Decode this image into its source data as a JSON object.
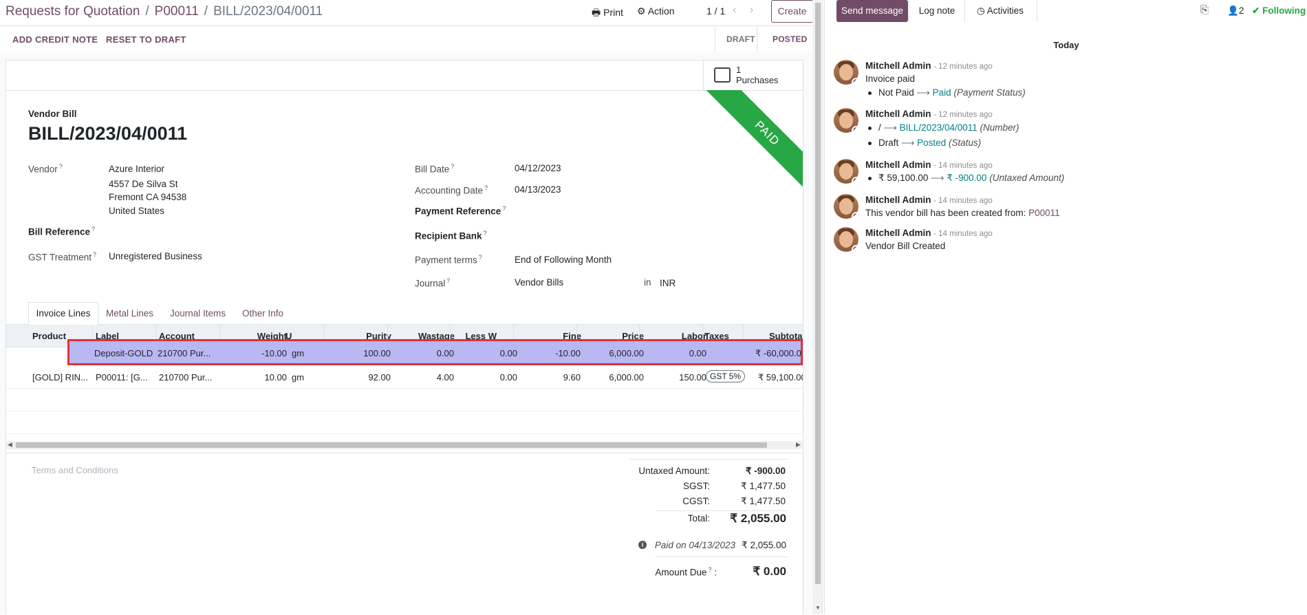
{
  "breadcrumb": {
    "items": [
      "Requests for Quotation",
      "P00011"
    ],
    "current": "BILL/2023/04/0011"
  },
  "toolbar": {
    "print_label": "Print",
    "action_label": "Action",
    "pager": "1 / 1",
    "create_label": "Create"
  },
  "statusbar": {
    "add_credit_note": "ADD CREDIT NOTE",
    "reset_to_draft": "RESET TO DRAFT",
    "stages": [
      "DRAFT",
      "POSTED"
    ],
    "active_stage": "POSTED"
  },
  "smart_button": {
    "count": "1",
    "label": "Purchases"
  },
  "ribbon": "PAID",
  "form": {
    "type_label": "Vendor Bill",
    "name": "BILL/2023/04/0011",
    "vendor_label": "Vendor",
    "vendor_name": "Azure Interior",
    "vendor_address": [
      "4557 De Silva St",
      "Fremont CA 94538",
      "United States"
    ],
    "bill_reference_label": "Bill Reference",
    "gst_treatment_label": "GST Treatment",
    "gst_treatment_value": "Unregistered Business",
    "bill_date_label": "Bill Date",
    "bill_date": "04/12/2023",
    "accounting_date_label": "Accounting Date",
    "accounting_date": "04/13/2023",
    "payment_reference_label": "Payment Reference",
    "recipient_bank_label": "Recipient Bank",
    "payment_terms_label": "Payment terms",
    "payment_terms": "End of Following Month",
    "journal_label": "Journal",
    "journal": "Vendor Bills",
    "journal_in": "in",
    "currency": "INR"
  },
  "tabs": [
    "Invoice Lines",
    "Metal Lines",
    "Journal Items",
    "Other Info"
  ],
  "active_tab": "Invoice Lines",
  "table": {
    "headers": [
      "Product",
      "Label",
      "Account",
      "Weight",
      "U",
      "Purity",
      "Wastage",
      "Less W",
      "Fine",
      "Price",
      "Labor",
      "Taxes",
      "Subtota"
    ],
    "rows": [
      {
        "product": "",
        "label": "Deposit-GOLD",
        "account": "210700 Pur...",
        "weight": "-10.00",
        "uom": "gm",
        "purity": "100.00",
        "wastage": "0.00",
        "less_w": "0.00",
        "fine": "-10.00",
        "price": "6,000.00",
        "labor": "0.00",
        "taxes": "",
        "subtotal": "₹ -60,000.0"
      },
      {
        "product": "[GOLD] RIN...",
        "label": "P00011: [G...",
        "account": "210700 Pur...",
        "weight": "10.00",
        "uom": "gm",
        "purity": "92.00",
        "wastage": "4.00",
        "less_w": "0.00",
        "fine": "9.60",
        "price": "6,000.00",
        "labor": "150.00",
        "taxes": "GST 5%",
        "subtotal": "₹ 59,100.00"
      }
    ]
  },
  "terms_placeholder": "Terms and Conditions",
  "totals": {
    "untaxed_label": "Untaxed Amount:",
    "untaxed": "₹ -900.00",
    "sgst_label": "SGST:",
    "sgst": "₹ 1,477.50",
    "cgst_label": "CGST:",
    "cgst": "₹ 1,477.50",
    "total_label": "Total:",
    "total": "₹ 2,055.00",
    "paid_on": "Paid on 04/13/2023",
    "paid_amount": "₹ 2,055.00",
    "amount_due_label": "Amount Due",
    "amount_due": "₹ 0.00"
  },
  "chatter": {
    "send_message": "Send message",
    "log_note": "Log note",
    "activities": "Activities",
    "followers_count": "2",
    "following": "Following",
    "date_separator": "Today",
    "messages": [
      {
        "author": "Mitchell Admin",
        "time": "- 12 minutes ago",
        "text": "Invoice paid",
        "changes": [
          {
            "from": "Not Paid",
            "to": "Paid",
            "field": "(Payment Status)"
          }
        ]
      },
      {
        "author": "Mitchell Admin",
        "time": "- 12 minutes ago",
        "text": "",
        "changes": [
          {
            "from": "/",
            "to": "BILL/2023/04/0011",
            "field": "(Number)"
          },
          {
            "from": "Draft",
            "to": "Posted",
            "field": "(Status)"
          }
        ]
      },
      {
        "author": "Mitchell Admin",
        "time": "- 14 minutes ago",
        "text": "",
        "changes": [
          {
            "from": "₹ 59,100.00",
            "to": "₹ -900.00",
            "field": "(Untaxed Amount)"
          }
        ]
      },
      {
        "author": "Mitchell Admin",
        "time": "- 14 minutes ago",
        "text": "This vendor bill has been created from:",
        "link": "P00011"
      },
      {
        "author": "Mitchell Admin",
        "time": "- 14 minutes ago",
        "text": "Vendor Bill Created"
      }
    ]
  },
  "colors": {
    "brand": "#714B67",
    "paid_ribbon": "#28a745",
    "highlight": "#b8b8f3",
    "highlight_border": "#e0303a",
    "teal": "#017e84"
  }
}
